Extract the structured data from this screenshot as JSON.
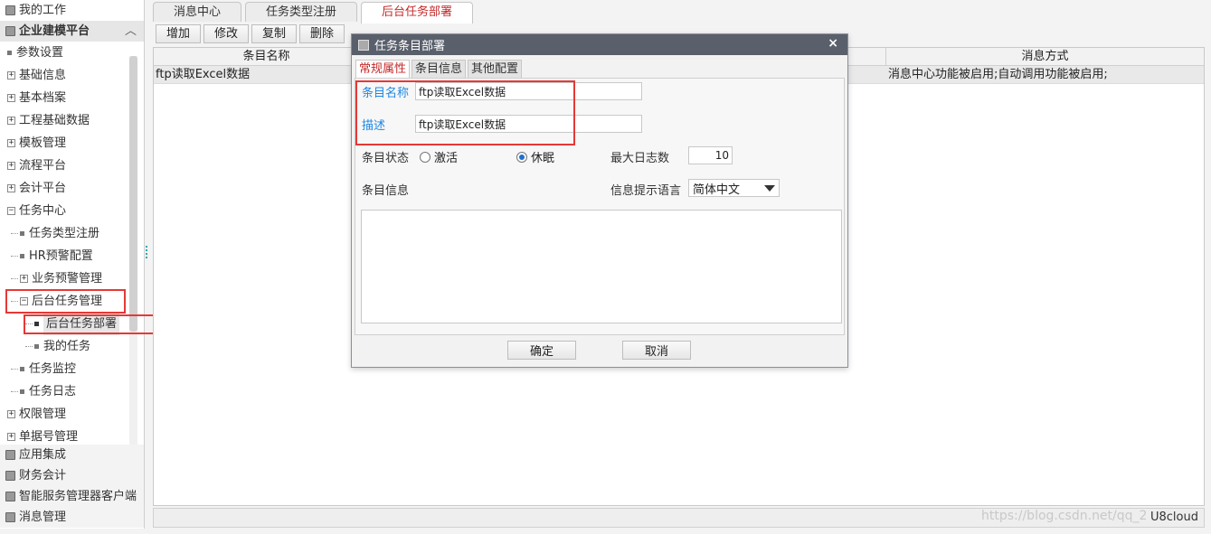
{
  "sidebar": {
    "my_work": "我的工作",
    "platform": "企业建模平台",
    "tree": {
      "params": "参数设置",
      "basic_info": "基础信息",
      "basic_archive": "基本档案",
      "eng_data": "工程基础数据",
      "template": "模板管理",
      "process": "流程平台",
      "accounting_platform": "会计平台",
      "task_center": "任务中心",
      "task_type_reg": "任务类型注册",
      "hr_alert": "HR预警配置",
      "biz_alert": "业务预警管理",
      "bg_task_mgmt": "后台任务管理",
      "bg_task_deploy": "后台任务部署",
      "my_tasks": "我的任务",
      "task_monitor": "任务监控",
      "task_log": "任务日志",
      "permission": "权限管理",
      "doc_number": "单据号管理"
    },
    "bottom": {
      "app_integration": "应用集成",
      "finance": "财务会计",
      "smart_service": "智能服务管理器客户端",
      "message_mgmt": "消息管理"
    }
  },
  "tabs": [
    "消息中心",
    "任务类型注册",
    "后台任务部署"
  ],
  "toolbar": {
    "add": "增加",
    "edit": "修改",
    "copy": "复制",
    "delete": "删除"
  },
  "grid": {
    "col_name": "条目名称",
    "col_msg": "消息方式",
    "row_name": "ftp读取Excel数据",
    "row_msg": "消息中心功能被启用;自动调用功能被启用;"
  },
  "status": {
    "product": "U8cloud"
  },
  "watermark": "https://blog.csdn.net/qq_2",
  "dialog": {
    "title": "任务条目部署",
    "close": "×",
    "tabs": [
      "常规属性",
      "条目信息",
      "其他配置"
    ],
    "name_label": "条目名称",
    "name_value": "ftp读取Excel数据",
    "desc_label": "描述",
    "desc_value": "ftp读取Excel数据",
    "state_label": "条目状态",
    "state_active": "激活",
    "state_sleep": "休眠",
    "max_log_label": "最大日志数",
    "max_log_value": "10",
    "info_label": "条目信息",
    "lang_label": "信息提示语言",
    "lang_value": "简体中文",
    "ok": "确定",
    "cancel": "取消"
  },
  "colors": {
    "accent_red": "#c62828",
    "highlight_red": "#e53935",
    "link_blue": "#1e88e5",
    "title_bar": "#595f6b"
  }
}
